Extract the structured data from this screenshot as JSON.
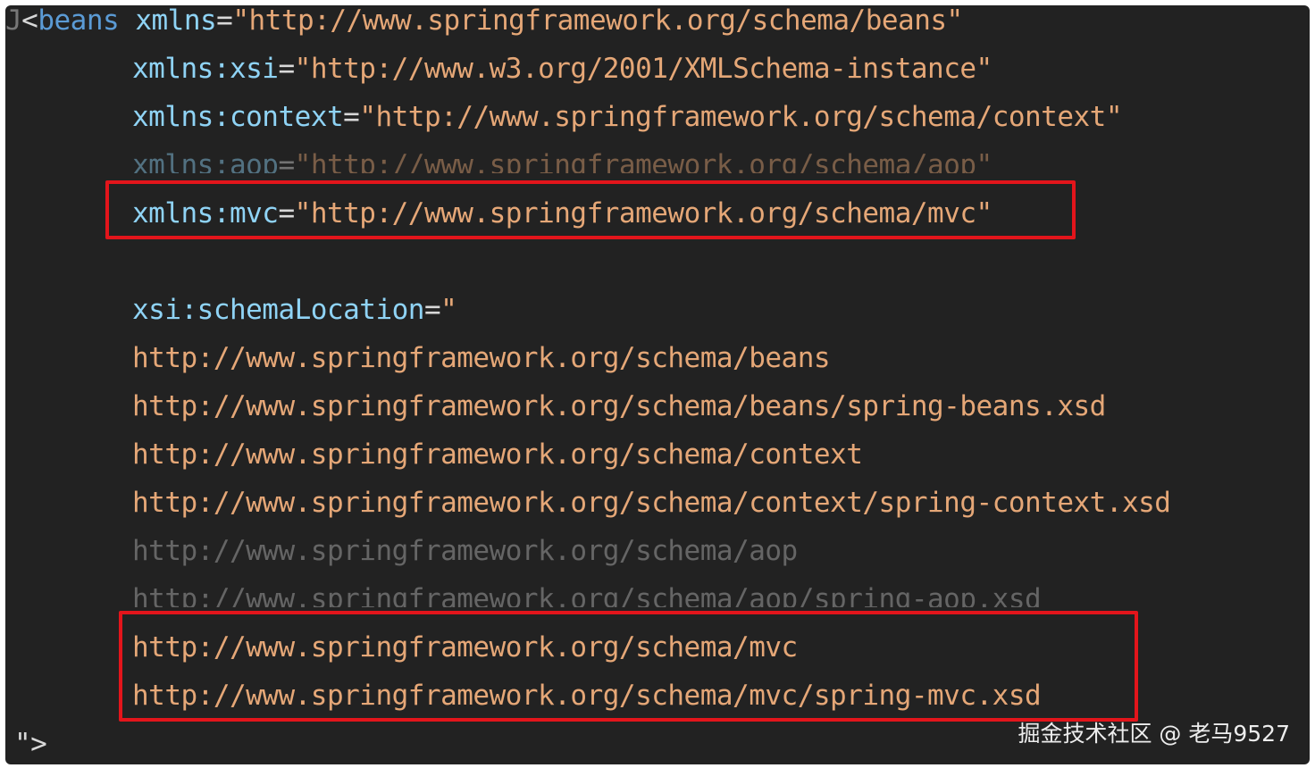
{
  "code": {
    "gutter_mark": "J",
    "open_bracket": "<",
    "tag_name": "beans",
    "namespaces": [
      {
        "attr": "xmlns",
        "value": "\"http://www.springframework.org/schema/beans\""
      },
      {
        "attr": "xmlns:xsi",
        "value": "\"http://www.w3.org/2001/XMLSchema-instance\""
      },
      {
        "attr": "xmlns:context",
        "value": "\"http://www.springframework.org/schema/context\""
      },
      {
        "attr": "xmlns:aop",
        "value": "\"http://www.springframework.org/schema/aop\""
      },
      {
        "attr": "xmlns:mvc",
        "value": "\"http://www.springframework.org/schema/mvc\""
      }
    ],
    "equals": "=",
    "schema_location_attr": "xsi:schemaLocation",
    "schema_location_open": "\"",
    "schema_urls": [
      "http://www.springframework.org/schema/beans",
      "http://www.springframework.org/schema/beans/spring-beans.xsd",
      "http://www.springframework.org/schema/context",
      "http://www.springframework.org/schema/context/spring-context.xsd",
      "http://www.springframework.org/schema/aop",
      "http://www.springframework.org/schema/aop/spring-aop.xsd",
      "http://www.springframework.org/schema/mvc",
      "http://www.springframework.org/schema/mvc/spring-mvc.xsd"
    ],
    "closing": "\">"
  },
  "watermark": "掘金技术社区 @ 老马9527",
  "colors": {
    "background": "#222222",
    "tag": "#5b9bd5",
    "attribute": "#8fd3f5",
    "string": "#e5a777",
    "highlight": "#e3151b"
  }
}
